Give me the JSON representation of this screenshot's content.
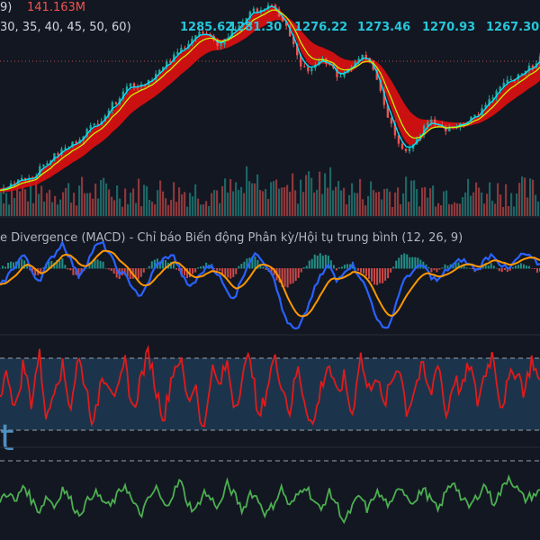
{
  "header": {
    "volume_prefix": "9)",
    "volume_value": "141.163M",
    "ema_periods": "30, 35, 40, 45, 50, 60)",
    "ema_values": [
      "1285.62",
      "1281.30",
      "1276.22",
      "1273.46",
      "1270.93",
      "1267.30"
    ]
  },
  "macd": {
    "label": "e Divergence (MACD) - Chỉ báo Biến động Phân kỳ/Hội tụ trung bình (12, 26, 9)"
  },
  "rsi_panel": {
    "watermark_glyph": "t"
  },
  "colors": {
    "background": "#131722",
    "price_up": "#26a69a",
    "price_down": "#ef5350",
    "ema_band": "#e01010",
    "ema_fast": "#00e5ff",
    "ema_mid": "#c6ff00",
    "macd_line": "#2962ff",
    "signal_line": "#ff9800",
    "hist_up": "#26a69a",
    "hist_down": "#ef5350",
    "rsi_line": "#e01b1b",
    "rsi_band": "#1f3a52",
    "osc_line": "#4caf50",
    "ema_value_text": "#26c6da",
    "dashed_guides": "#9aa0a6",
    "top_dotted": "#c34a4a"
  },
  "chart_data": {
    "type": "line",
    "price_shape": [
      0.08,
      0.1,
      0.13,
      0.15,
      0.14,
      0.18,
      0.22,
      0.25,
      0.28,
      0.3,
      0.33,
      0.37,
      0.4,
      0.43,
      0.48,
      0.52,
      0.58,
      0.61,
      0.6,
      0.62,
      0.65,
      0.68,
      0.72,
      0.76,
      0.8,
      0.84,
      0.86,
      0.84,
      0.8,
      0.82,
      0.86,
      0.9,
      0.94,
      0.97,
      0.98,
      0.99,
      0.96,
      0.9,
      0.8,
      0.7,
      0.66,
      0.7,
      0.74,
      0.68,
      0.64,
      0.68,
      0.72,
      0.76,
      0.73,
      0.62,
      0.48,
      0.38,
      0.3,
      0.28,
      0.34,
      0.4,
      0.42,
      0.4,
      0.38,
      0.4,
      0.42,
      0.44,
      0.46,
      0.5,
      0.55,
      0.6,
      0.62,
      0.64,
      0.66,
      0.7,
      0.74
    ],
    "macd_shape": [
      0.4,
      0.5,
      0.6,
      0.7,
      0.55,
      0.45,
      0.6,
      0.7,
      0.8,
      0.65,
      0.5,
      0.6,
      0.75,
      0.8,
      0.7,
      0.55,
      0.5,
      0.4,
      0.3,
      0.45,
      0.6,
      0.65,
      0.7,
      0.55,
      0.4,
      0.45,
      0.55,
      0.6,
      0.5,
      0.35,
      0.3,
      0.5,
      0.65,
      0.7,
      0.6,
      0.5,
      0.2,
      0.05,
      0.0,
      0.15,
      0.35,
      0.5,
      0.6,
      0.45,
      0.55,
      0.6,
      0.5,
      0.35,
      0.15,
      0.0,
      0.1,
      0.35,
      0.5,
      0.55,
      0.6,
      0.5,
      0.45,
      0.55,
      0.6,
      0.65,
      0.6,
      0.55,
      0.65,
      0.7,
      0.6,
      0.55,
      0.65,
      0.7,
      0.65,
      0.6
    ],
    "rsi_shape": [
      0.5,
      0.7,
      0.3,
      0.8,
      0.4,
      0.9,
      0.2,
      0.6,
      0.75,
      0.35,
      0.85,
      0.55,
      0.15,
      0.7,
      0.6,
      0.45,
      0.8,
      0.3,
      0.65,
      0.9,
      0.5,
      0.25,
      0.7,
      0.85,
      0.4,
      0.6,
      0.05,
      0.75,
      0.55,
      0.8,
      0.35,
      0.65,
      0.9,
      0.2,
      0.5,
      0.85,
      0.6,
      0.3,
      0.75,
      0.4,
      0.15,
      0.55,
      0.8,
      0.45,
      0.65,
      0.25,
      0.9,
      0.5,
      0.7,
      0.35,
      0.6,
      0.8,
      0.3,
      0.55,
      0.75,
      0.45,
      0.85,
      0.25,
      0.65,
      0.5,
      0.8,
      0.4,
      0.7,
      0.9,
      0.35,
      0.6,
      0.75,
      0.5,
      0.85,
      0.55
    ],
    "osc_shape": [
      0.5,
      0.6,
      0.45,
      0.7,
      0.5,
      0.35,
      0.55,
      0.4,
      0.65,
      0.5,
      0.3,
      0.45,
      0.6,
      0.5,
      0.4,
      0.55,
      0.7,
      0.45,
      0.3,
      0.5,
      0.65,
      0.4,
      0.55,
      0.75,
      0.45,
      0.35,
      0.6,
      0.5,
      0.4,
      0.7,
      0.55,
      0.35,
      0.6,
      0.5,
      0.3,
      0.45,
      0.65,
      0.4,
      0.55,
      0.7,
      0.5,
      0.35,
      0.6,
      0.45,
      0.2,
      0.4,
      0.55,
      0.35,
      0.6,
      0.5,
      0.4,
      0.7,
      0.55,
      0.45,
      0.65,
      0.5,
      0.35,
      0.6,
      0.75,
      0.5,
      0.4,
      0.55,
      0.7,
      0.45,
      0.6,
      0.8,
      0.65,
      0.5,
      0.55,
      0.6
    ]
  }
}
